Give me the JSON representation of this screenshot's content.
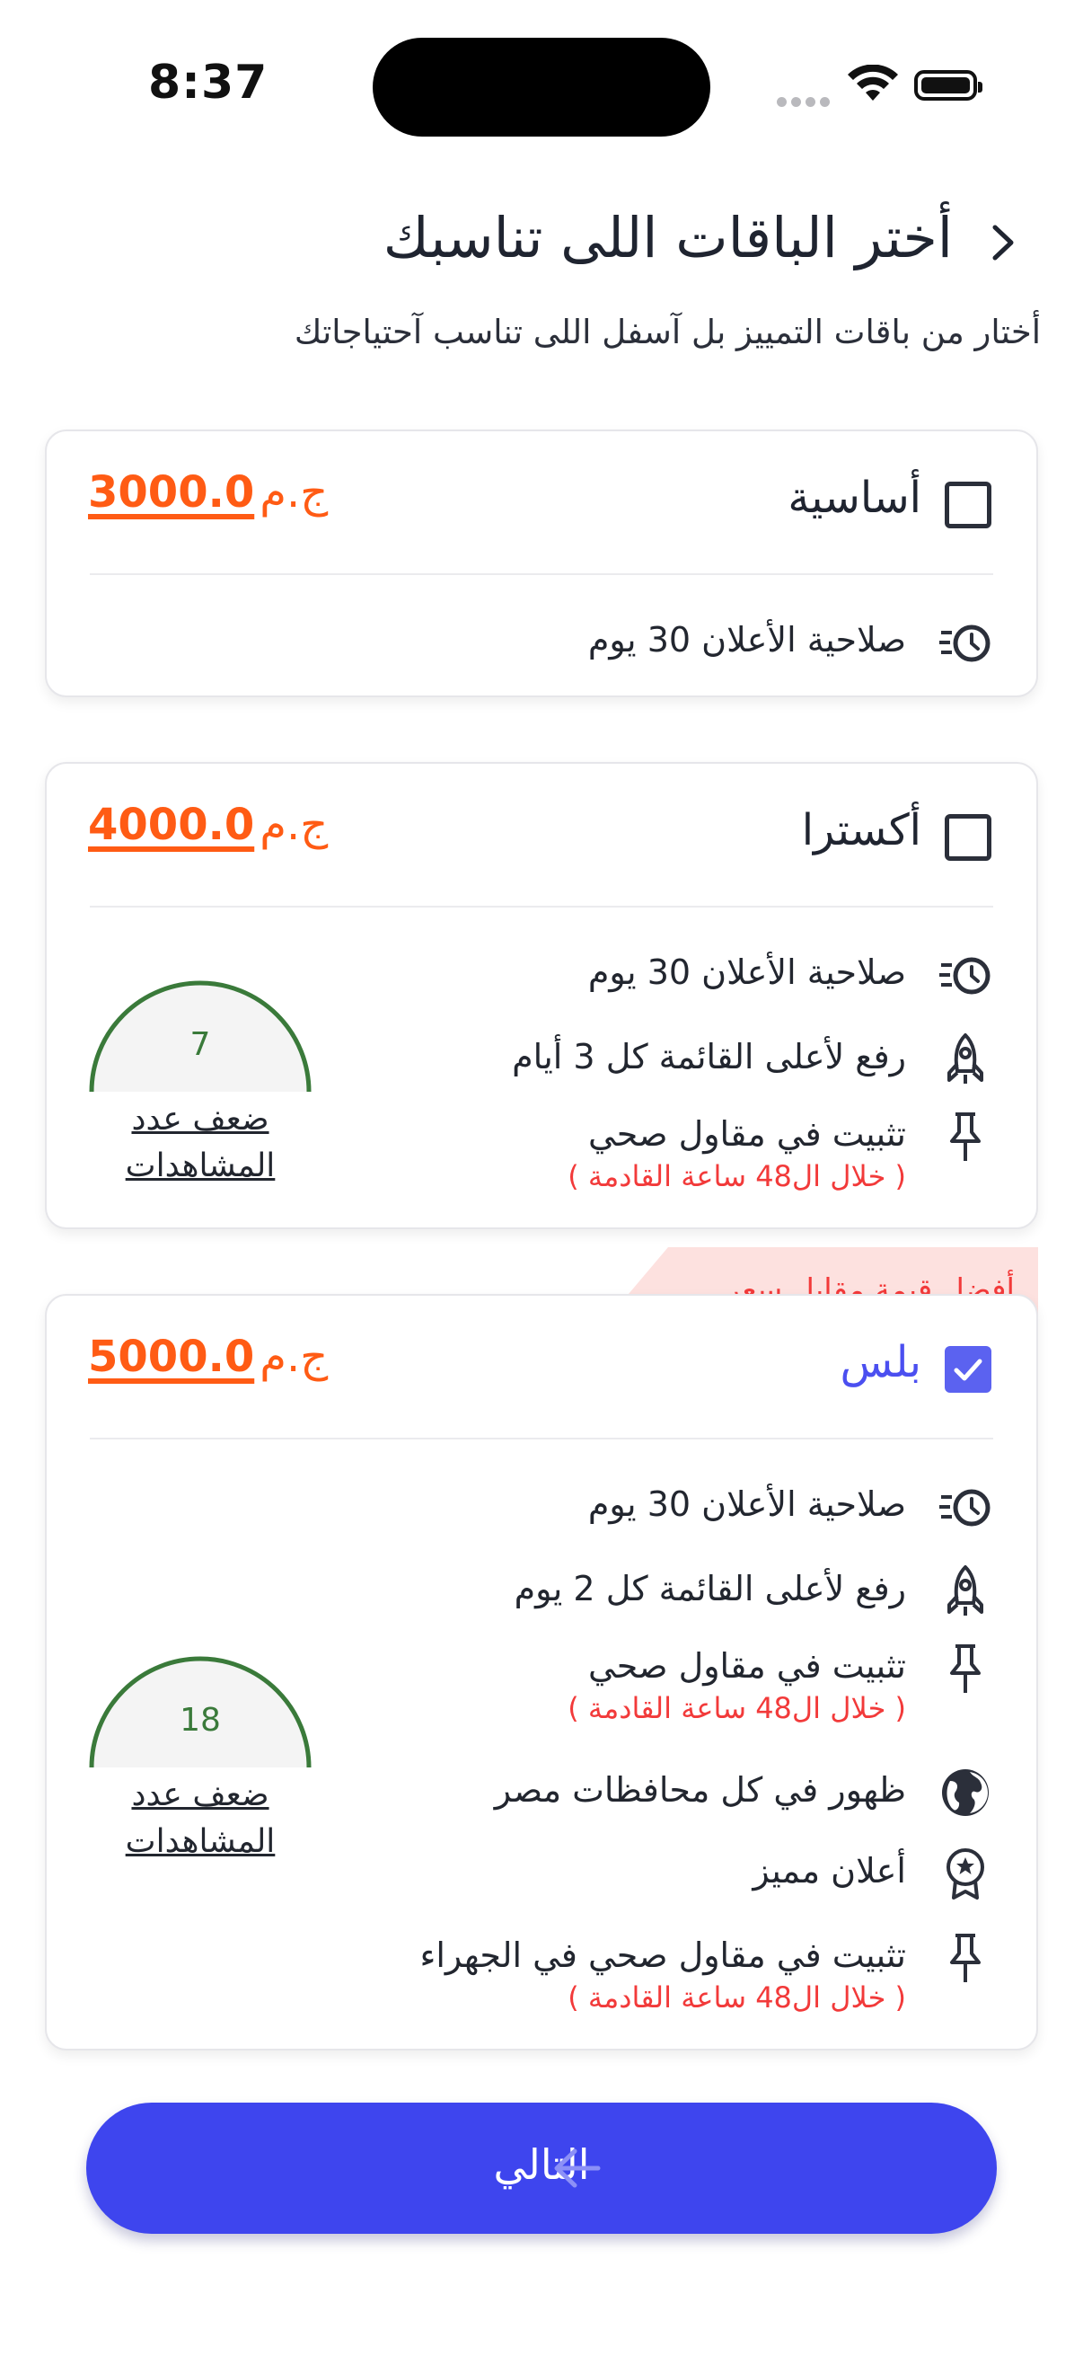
{
  "status_bar": {
    "time": "8:37"
  },
  "header": {
    "title": "أختر الباقات اللى تناسبك",
    "subtitle": "أختار من باقات التمييز بل آسفل اللى تناسب آحتياجاتك"
  },
  "packages": [
    {
      "name": "أساسية",
      "price": "3000.0",
      "currency": "ج.م",
      "selected": false,
      "features": [
        {
          "icon": "clock-list-icon",
          "text": "صلاحية الأعلان 30 يوم"
        }
      ]
    },
    {
      "name": "أكسترا",
      "price": "4000.0",
      "currency": "ج.م",
      "selected": false,
      "gauge": {
        "value": "7",
        "label": "ضعف عدد المشاهدات"
      },
      "features": [
        {
          "icon": "clock-list-icon",
          "text": "صلاحية الأعلان 30 يوم"
        },
        {
          "icon": "rocket-icon",
          "text": "رفع لأعلى القائمة كل 3 أيام"
        },
        {
          "icon": "pin-icon",
          "text": "تثبيت في مقاول صحي",
          "note": "( خلال ال48 ساعة القادمة )"
        }
      ]
    },
    {
      "name": "بلس",
      "price": "5000.0",
      "currency": "ج.م",
      "selected": true,
      "ribbon": "أفضل قيمة مقابل سعر",
      "gauge": {
        "value": "18",
        "label": "ضعف عدد المشاهدات"
      },
      "features": [
        {
          "icon": "clock-list-icon",
          "text": "صلاحية الأعلان 30 يوم"
        },
        {
          "icon": "rocket-icon",
          "text": "رفع لأعلى القائمة كل 2 يوم"
        },
        {
          "icon": "pin-icon",
          "text": "تثبيت في مقاول صحي",
          "note": "( خلال ال48 ساعة القادمة )"
        },
        {
          "icon": "globe-icon",
          "text": "ظهور في كل محافظات مصر"
        },
        {
          "icon": "award-icon",
          "text": "أعلان مميز"
        },
        {
          "icon": "pin-icon",
          "text": "تثبيت في مقاول صحي في الجهراء",
          "note": "( خلال ال48 ساعة القادمة )"
        }
      ]
    }
  ],
  "footer": {
    "next_label": "التالي"
  },
  "colors": {
    "accent": "#3e45ee",
    "price": "#ff5b14",
    "note": "#f23a3a",
    "gauge": "#3a7a3a"
  }
}
